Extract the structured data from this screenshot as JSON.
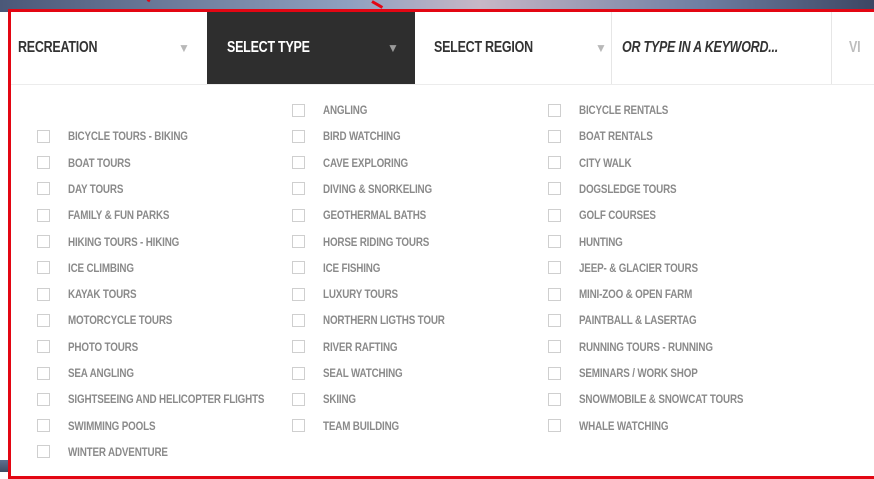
{
  "filter_bar": {
    "recreation_label": "RECREATION",
    "type_label": "SELECT TYPE",
    "region_label": "SELECT REGION",
    "keyword_placeholder": "OR TYPE IN A KEYWORD...",
    "view_label": "VI",
    "caret": "▼"
  },
  "columns": [
    [
      "",
      "BICYCLE TOURS - BIKING",
      "BOAT TOURS",
      "DAY TOURS",
      "FAMILY & FUN PARKS",
      "HIKING TOURS - HIKING",
      "ICE CLIMBING",
      "KAYAK TOURS",
      "MOTORCYCLE TOURS",
      "PHOTO TOURS",
      "SEA ANGLING",
      "SIGHTSEEING AND HELICOPTER FLIGHTS",
      "SWIMMING POOLS",
      "WINTER ADVENTURE"
    ],
    [
      "ANGLING",
      "BIRD WATCHING",
      "CAVE EXPLORING",
      "DIVING & SNORKELING",
      "GEOTHERMAL BATHS",
      "HORSE RIDING TOURS",
      "ICE FISHING",
      "LUXURY TOURS",
      "NORTHERN LIGTHS TOUR",
      "RIVER RAFTING",
      "SEAL WATCHING",
      "SKIING",
      "TEAM BUILDING"
    ],
    [
      "BICYCLE RENTALS",
      "BOAT RENTALS",
      "CITY WALK",
      "DOGSLEDGE TOURS",
      "GOLF COURSES",
      "HUNTING",
      "JEEP- & GLACIER TOURS",
      "MINI-ZOO & OPEN FARM",
      "PAINTBALL & LASERTAG",
      "RUNNING TOURS - RUNNING",
      "SEMINARS / WORK SHOP",
      "SNOWMOBILE & SNOWCAT TOURS",
      "WHALE WATCHING"
    ]
  ],
  "colors": {
    "frame": "#e30613",
    "active_segment": "#2e2e2e"
  }
}
